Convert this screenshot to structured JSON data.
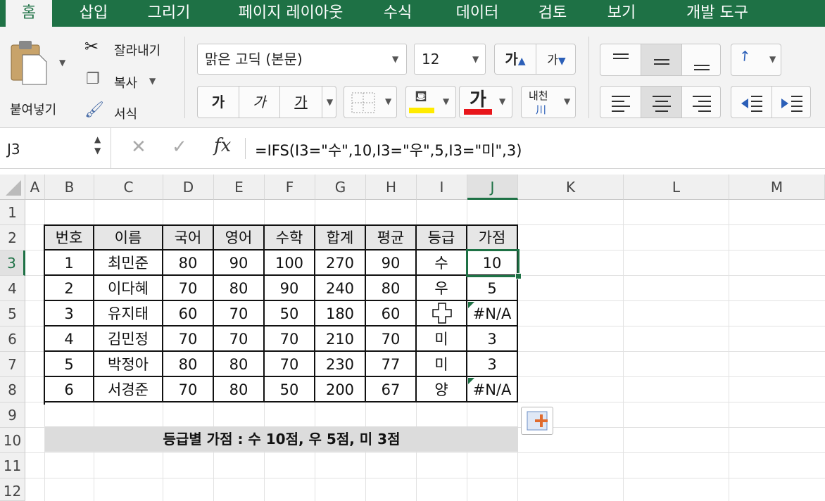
{
  "tabs": [
    "홈",
    "삽입",
    "그리기",
    "페이지 레이아웃",
    "수식",
    "데이터",
    "검토",
    "보기",
    "개발 도구"
  ],
  "ribbon": {
    "paste": "붙여넣기",
    "cut": "잘라내기",
    "copy": "복사",
    "format_painter": "서식",
    "font_name": "맑은 고딕 (본문)",
    "font_size": "12",
    "grow_font": "가",
    "shrink_font": "가",
    "bold": "가",
    "italic": "가",
    "underline": "가",
    "font_color": "가",
    "phonetic": "내천"
  },
  "formula_bar": {
    "name_box": "J3",
    "cancel": "✕",
    "enter": "✓",
    "fx": "fx",
    "formula": "=IFS(I3=\"수\",10,I3=\"우\",5,I3=\"미\",3)"
  },
  "columns": [
    "A",
    "B",
    "C",
    "D",
    "E",
    "F",
    "G",
    "H",
    "I",
    "J",
    "K",
    "L",
    "M"
  ],
  "rows": [
    "1",
    "2",
    "3",
    "4",
    "5",
    "6",
    "7",
    "8",
    "9",
    "10",
    "11",
    "12"
  ],
  "table": {
    "headers": [
      "번호",
      "이름",
      "국어",
      "영어",
      "수학",
      "합계",
      "평균",
      "등급",
      "가점"
    ],
    "rows": [
      [
        "1",
        "최민준",
        "80",
        "90",
        "100",
        "270",
        "90",
        "수",
        "10"
      ],
      [
        "2",
        "이다혜",
        "70",
        "80",
        "90",
        "240",
        "80",
        "우",
        "5"
      ],
      [
        "3",
        "유지태",
        "60",
        "70",
        "50",
        "180",
        "60",
        "",
        "#N/A"
      ],
      [
        "4",
        "김민정",
        "70",
        "70",
        "70",
        "210",
        "70",
        "미",
        "3"
      ],
      [
        "5",
        "박정아",
        "80",
        "80",
        "70",
        "230",
        "77",
        "미",
        "3"
      ],
      [
        "6",
        "서경준",
        "70",
        "80",
        "50",
        "200",
        "67",
        "양",
        "#N/A"
      ]
    ]
  },
  "note": "등급별 가점 : 수 10점, 우 5점, 미 3점",
  "colors": {
    "accent": "#1e7145",
    "fill_yellow": "#ffeb00",
    "font_red": "#e8161b"
  }
}
